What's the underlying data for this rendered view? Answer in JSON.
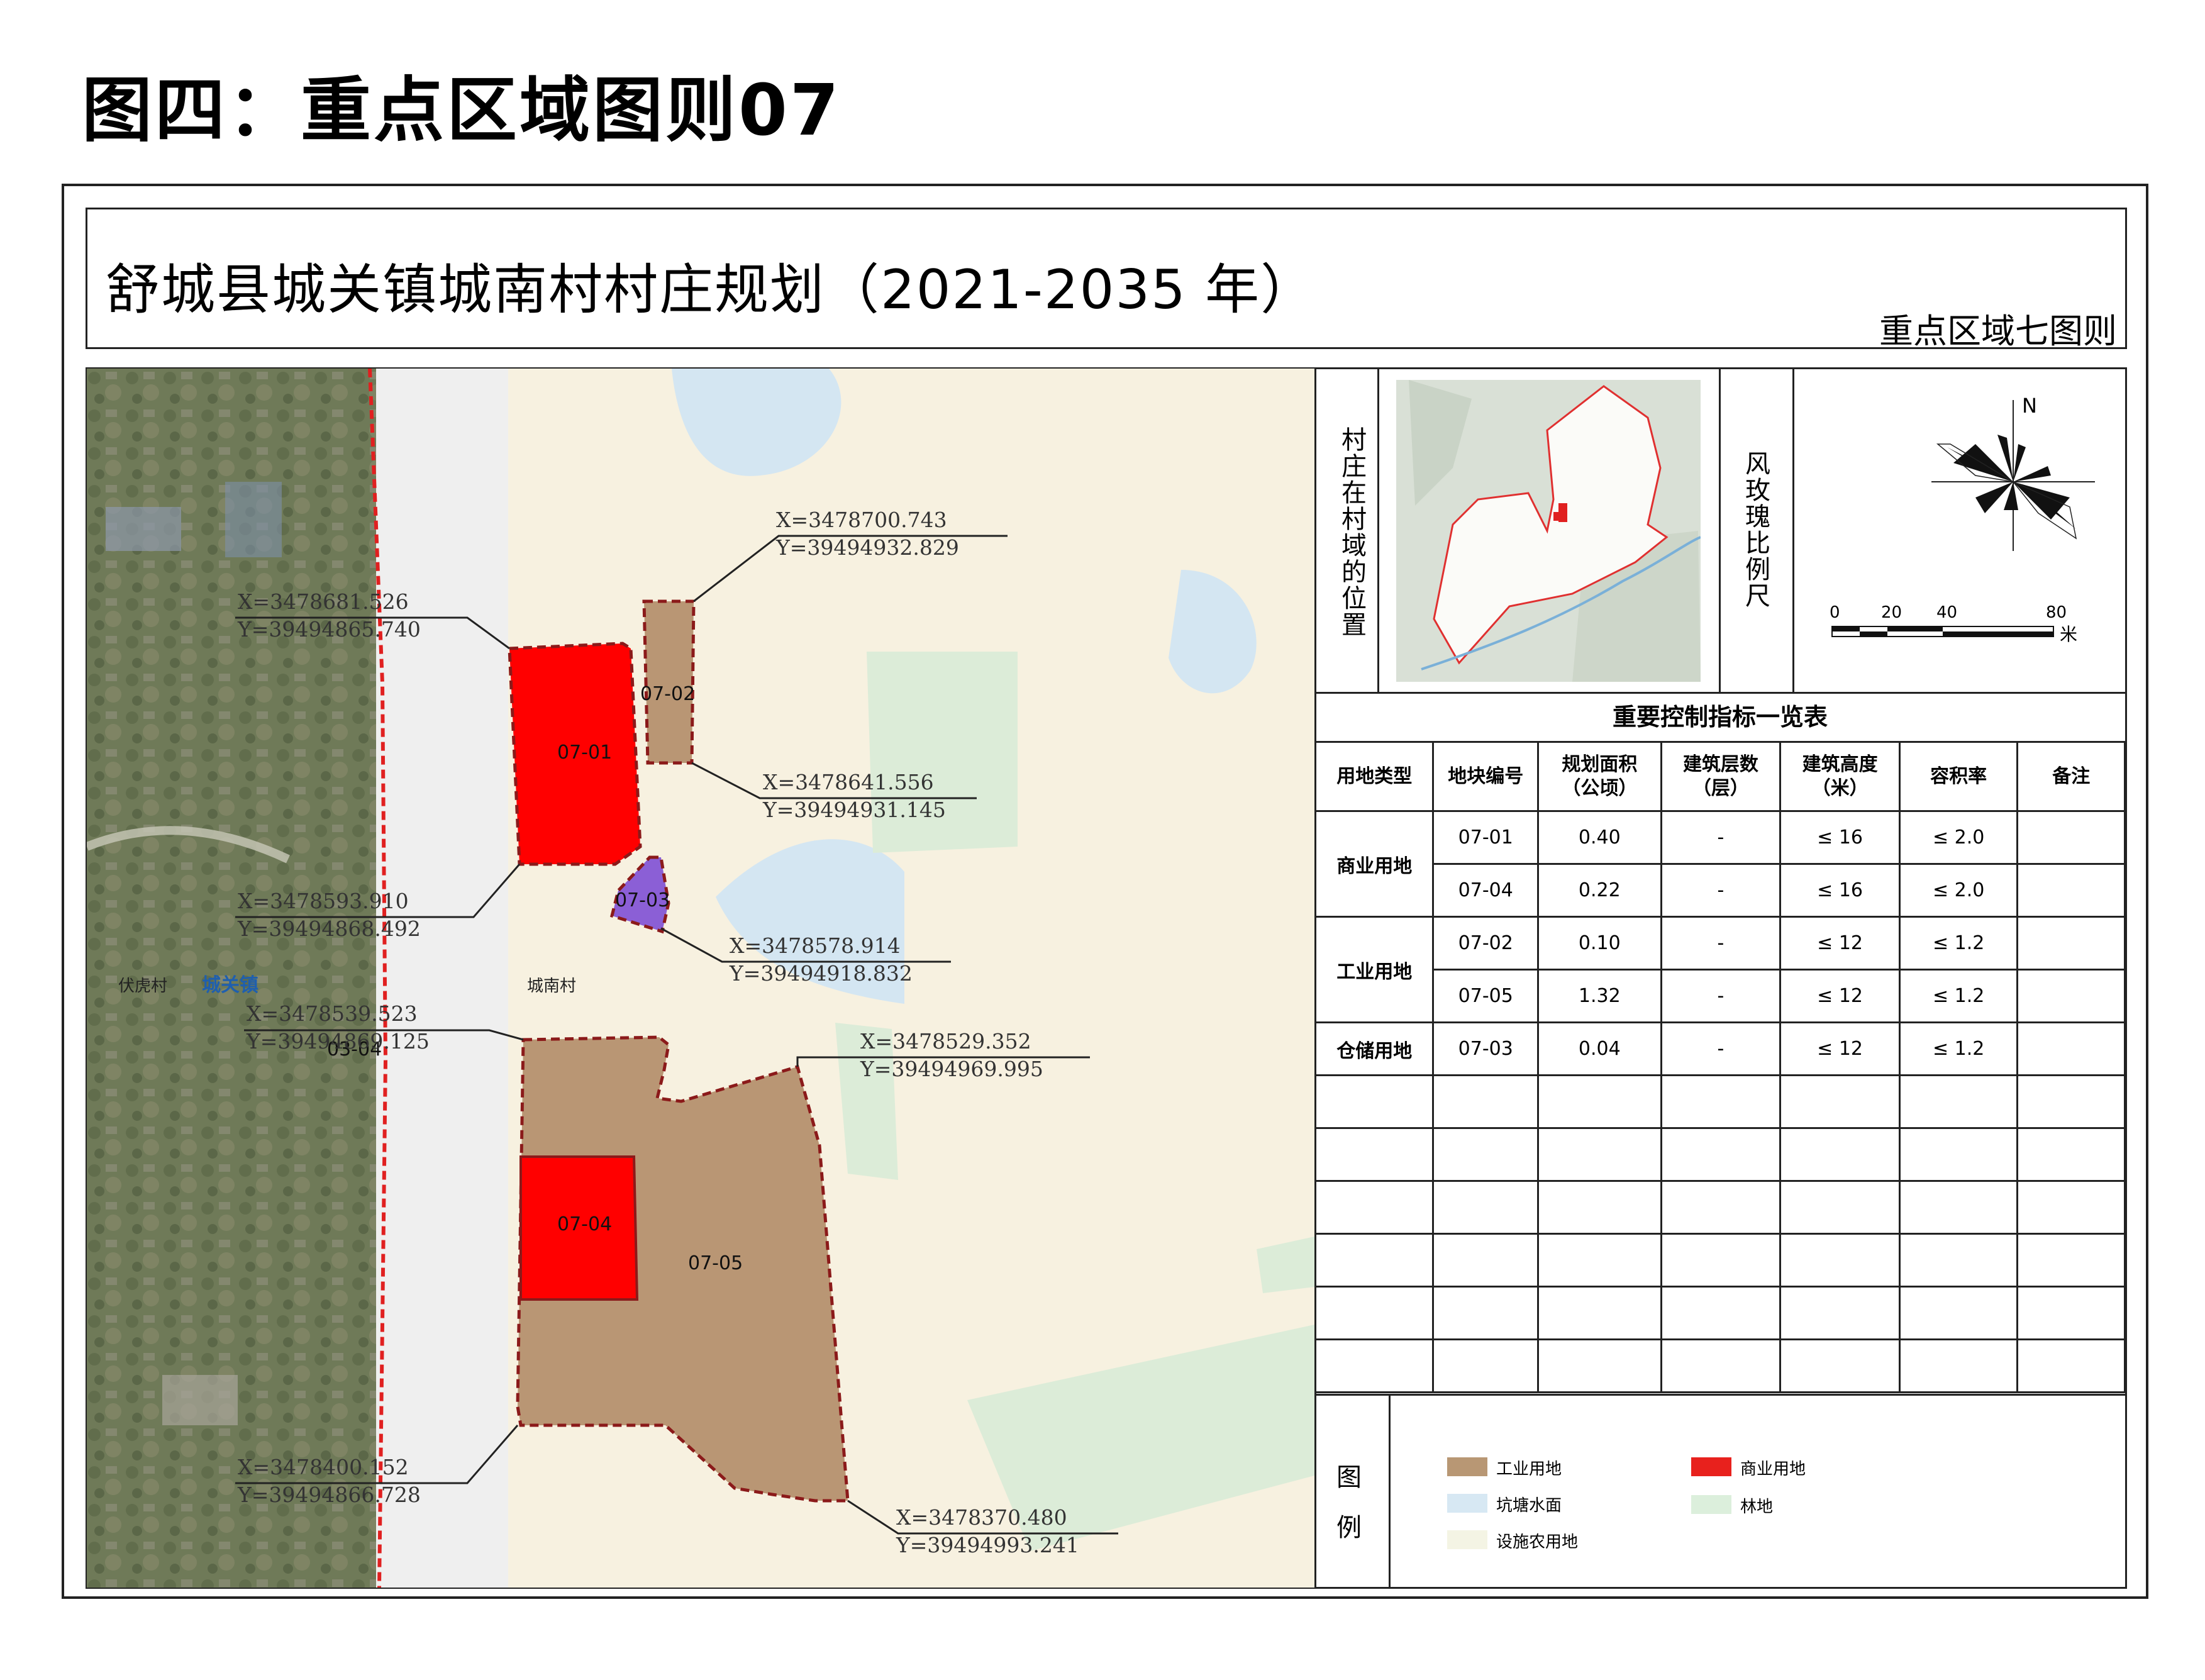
{
  "page_title": "图四：重点区域图则07",
  "plan": {
    "title": "舒城县城关镇城南村村庄规划（2021-2035 年）",
    "subtitle": "重点区域七图则"
  },
  "map": {
    "places": {
      "fuhu": "伏虎村",
      "chengguan": "城关镇",
      "chengnan": "城南村",
      "road_code": "03-04"
    },
    "parcels": [
      {
        "id": "07-01",
        "land_use": "商业用地"
      },
      {
        "id": "07-02",
        "land_use": "工业用地"
      },
      {
        "id": "07-03",
        "land_use": "仓储用地"
      },
      {
        "id": "07-04",
        "land_use": "商业用地"
      },
      {
        "id": "07-05",
        "land_use": "工业用地"
      }
    ],
    "coordinates": [
      {
        "x": "X=3478700.743",
        "y": "Y=39494932.829"
      },
      {
        "x": "X=3478681.526",
        "y": "Y=39494865.740"
      },
      {
        "x": "X=3478641.556",
        "y": "Y=39494931.145"
      },
      {
        "x": "X=3478593.910",
        "y": "Y=39494868.492"
      },
      {
        "x": "X=3478578.914",
        "y": "Y=39494918.832"
      },
      {
        "x": "X=3478539.523",
        "y": "Y=39494869.125"
      },
      {
        "x": "X=3478529.352",
        "y": "Y=39494969.995"
      },
      {
        "x": "X=3478400.152",
        "y": "Y=39494866.728"
      },
      {
        "x": "X=3478370.480",
        "y": "Y=39494993.241"
      }
    ]
  },
  "location_panel": {
    "label": "村庄在村域的位置",
    "wind_label": "风玫瑰比例尺",
    "north": "N",
    "scale_ticks": [
      "0",
      "20",
      "40",
      "80"
    ],
    "scale_unit": "米"
  },
  "table": {
    "title": "重要控制指标一览表",
    "headers": [
      "用地类型",
      "地块编号",
      "规划面积（公顷）",
      "建筑层数（层）",
      "建筑高度（米）",
      "容积率",
      "备注"
    ],
    "header_lines": [
      [
        "用地类型"
      ],
      [
        "地块编号"
      ],
      [
        "规划面积",
        "（公顷）"
      ],
      [
        "建筑层数",
        "（层）"
      ],
      [
        "建筑高度",
        "（米）"
      ],
      [
        "容积率"
      ],
      [
        "备注"
      ]
    ],
    "rows": [
      {
        "type": "商业用地",
        "code": "07-01",
        "area": "0.40",
        "floors": "-",
        "height": "≤ 16",
        "far": "≤ 2.0",
        "note": ""
      },
      {
        "type": "",
        "code": "07-04",
        "area": "0.22",
        "floors": "-",
        "height": "≤ 16",
        "far": "≤ 2.0",
        "note": ""
      },
      {
        "type": "工业用地",
        "code": "07-02",
        "area": "0.10",
        "floors": "-",
        "height": "≤ 12",
        "far": "≤ 1.2",
        "note": ""
      },
      {
        "type": "",
        "code": "07-05",
        "area": "1.32",
        "floors": "-",
        "height": "≤ 12",
        "far": "≤ 1.2",
        "note": ""
      },
      {
        "type": "仓储用地",
        "code": "07-03",
        "area": "0.04",
        "floors": "-",
        "height": "≤ 12",
        "far": "≤ 1.2",
        "note": ""
      }
    ],
    "empty_rows": 6
  },
  "legend": {
    "title": "图例",
    "items": [
      {
        "label": "工业用地",
        "color": "#b89774"
      },
      {
        "label": "商业用地",
        "color": "#e8211d"
      },
      {
        "label": "坑塘水面",
        "color": "#d7e8f3"
      },
      {
        "label": "林地",
        "color": "#dcefdc"
      },
      {
        "label": "设施农用地",
        "color": "#f4f4e4"
      }
    ]
  },
  "colors": {
    "commercial": "#ff0000",
    "industrial": "#b99674",
    "warehouse": "#8b5fd6",
    "boundary": "#8b1a1a",
    "background_land": "#f7f1e0",
    "water": "#cfe4f2",
    "forest": "#dcecd8",
    "road": "#efefef"
  }
}
